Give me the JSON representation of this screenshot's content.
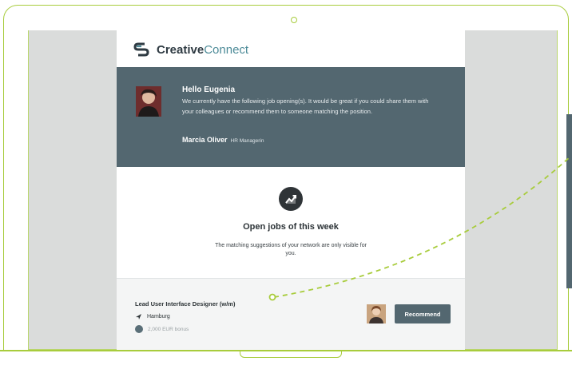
{
  "brand": {
    "name_bold": "Creative",
    "name_light": "Connect"
  },
  "hero": {
    "greeting": "Hello Eugenia",
    "message": "We currently have the following job opening(s). It would be great if you could share them with your colleagues or recommend them to someone matching the position.",
    "sender_name": "Marcia Oliver",
    "sender_role": "HR Managerin"
  },
  "jobs": {
    "title": "Open jobs of this week",
    "subtitle": "The matching suggestions of your network are only visible for you."
  },
  "listing": {
    "job_title": "Lead User Interface Designer (w/m)",
    "location": "Hamburg",
    "bonus": "2,000 EUR bonus",
    "recommend_label": "Recommend"
  },
  "colors": {
    "accent_green": "#a8cc3c",
    "slate": "#536770",
    "screen_bg": "#dadcdb"
  },
  "icons": [
    "camera-dot-icon",
    "brand-logo-icon",
    "trending-chart-icon",
    "location-arrow-icon",
    "coin-icon"
  ]
}
